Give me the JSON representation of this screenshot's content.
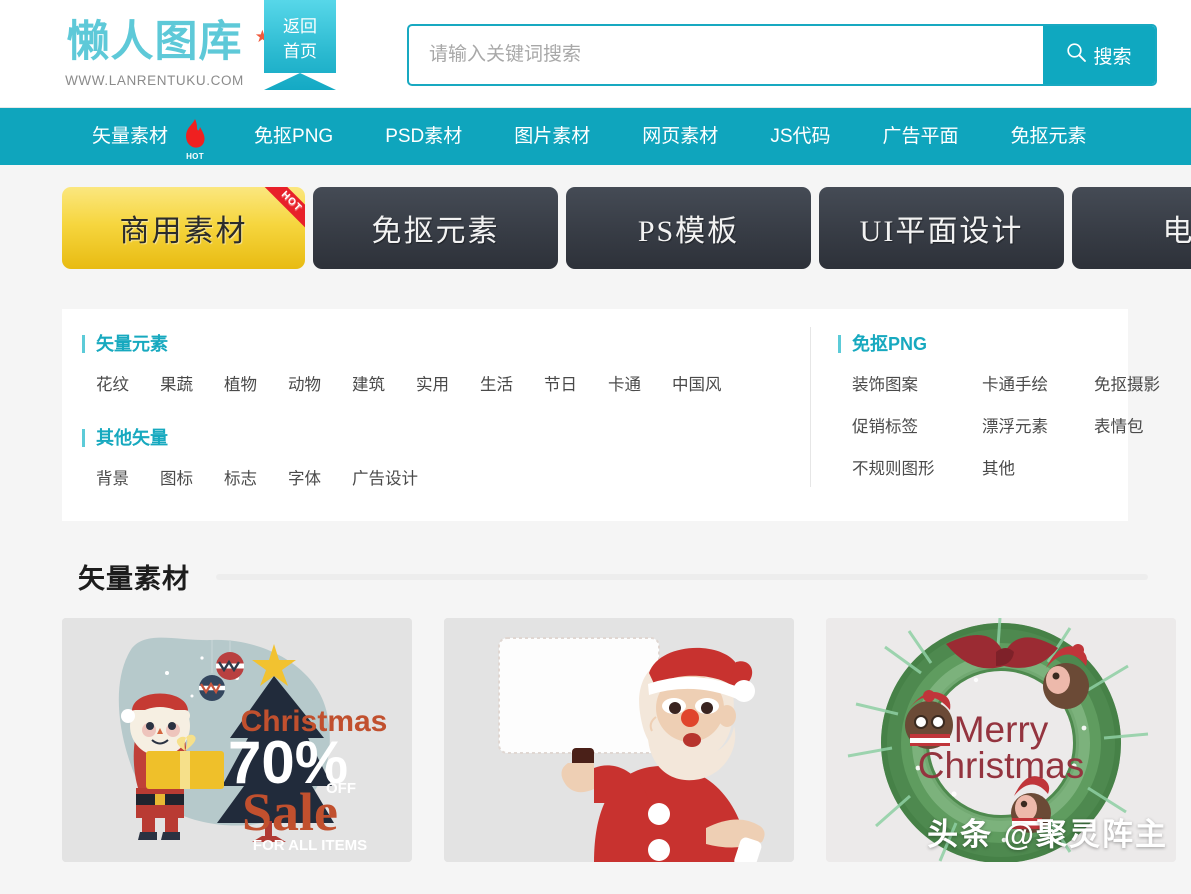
{
  "header": {
    "logo_text": "懒人图库",
    "logo_url": "WWW.LANRENTUKU.COM",
    "logo_star": "★",
    "ribbon_line1": "返回",
    "ribbon_line2": "首页"
  },
  "search": {
    "placeholder": "请输入关键词搜索",
    "value": "",
    "button_label": "搜索",
    "icon": "search-icon"
  },
  "nav": {
    "items": [
      {
        "label": "矢量素材",
        "badge": "HOT"
      },
      {
        "label": "免抠PNG",
        "badge": ""
      },
      {
        "label": "PSD素材",
        "badge": ""
      },
      {
        "label": "图片素材",
        "badge": ""
      },
      {
        "label": "网页素材",
        "badge": ""
      },
      {
        "label": "JS代码",
        "badge": ""
      },
      {
        "label": "广告平面",
        "badge": ""
      },
      {
        "label": "免抠元素",
        "badge": ""
      }
    ]
  },
  "tabs": [
    {
      "label": "商用素材",
      "active": true,
      "corner": "HOT"
    },
    {
      "label": "免抠元素",
      "active": false,
      "corner": ""
    },
    {
      "label": "PS模板",
      "active": false,
      "corner": ""
    },
    {
      "label": "UI平面设计",
      "active": false,
      "corner": ""
    },
    {
      "label": "电商",
      "active": false,
      "corner": ""
    }
  ],
  "filters": {
    "left": [
      {
        "title": "矢量元素",
        "tags": [
          "花纹",
          "果蔬",
          "植物",
          "动物",
          "建筑",
          "实用",
          "生活",
          "节日",
          "卡通",
          "中国风"
        ]
      },
      {
        "title": "其他矢量",
        "tags": [
          "背景",
          "图标",
          "标志",
          "字体",
          "广告设计"
        ]
      }
    ],
    "right": {
      "title": "免抠PNG",
      "tags": [
        "装饰图案",
        "卡通手绘",
        "免抠摄影",
        "促销标签",
        "漂浮元素",
        "表情包",
        "不规则图形",
        "其他"
      ]
    }
  },
  "section": {
    "title": "矢量素材"
  },
  "cards": [
    {
      "name": "christmas-sale-poster",
      "texts": {
        "line1": "Christmas",
        "line2": "70",
        "percent": "%",
        "off": "OFF",
        "line3": "Sale",
        "line4": "FOR ALL ITEMS"
      }
    },
    {
      "name": "santa-holding-blank-sign",
      "texts": {}
    },
    {
      "name": "merry-christmas-wreath",
      "texts": {
        "line1": "Merry",
        "line2": "Christmas"
      }
    }
  ],
  "watermark": {
    "text": "头条 @聚灵阵主"
  },
  "colors": {
    "brand_teal": "#0fa5bd",
    "brand_teal_dark": "#0fa8c0",
    "ribbon_light": "#57d7e9",
    "accent_gold": "#f6d63f",
    "hot_red": "#e8202a",
    "page_bg": "#f5f5f5",
    "tab_dark": "#383d46"
  }
}
